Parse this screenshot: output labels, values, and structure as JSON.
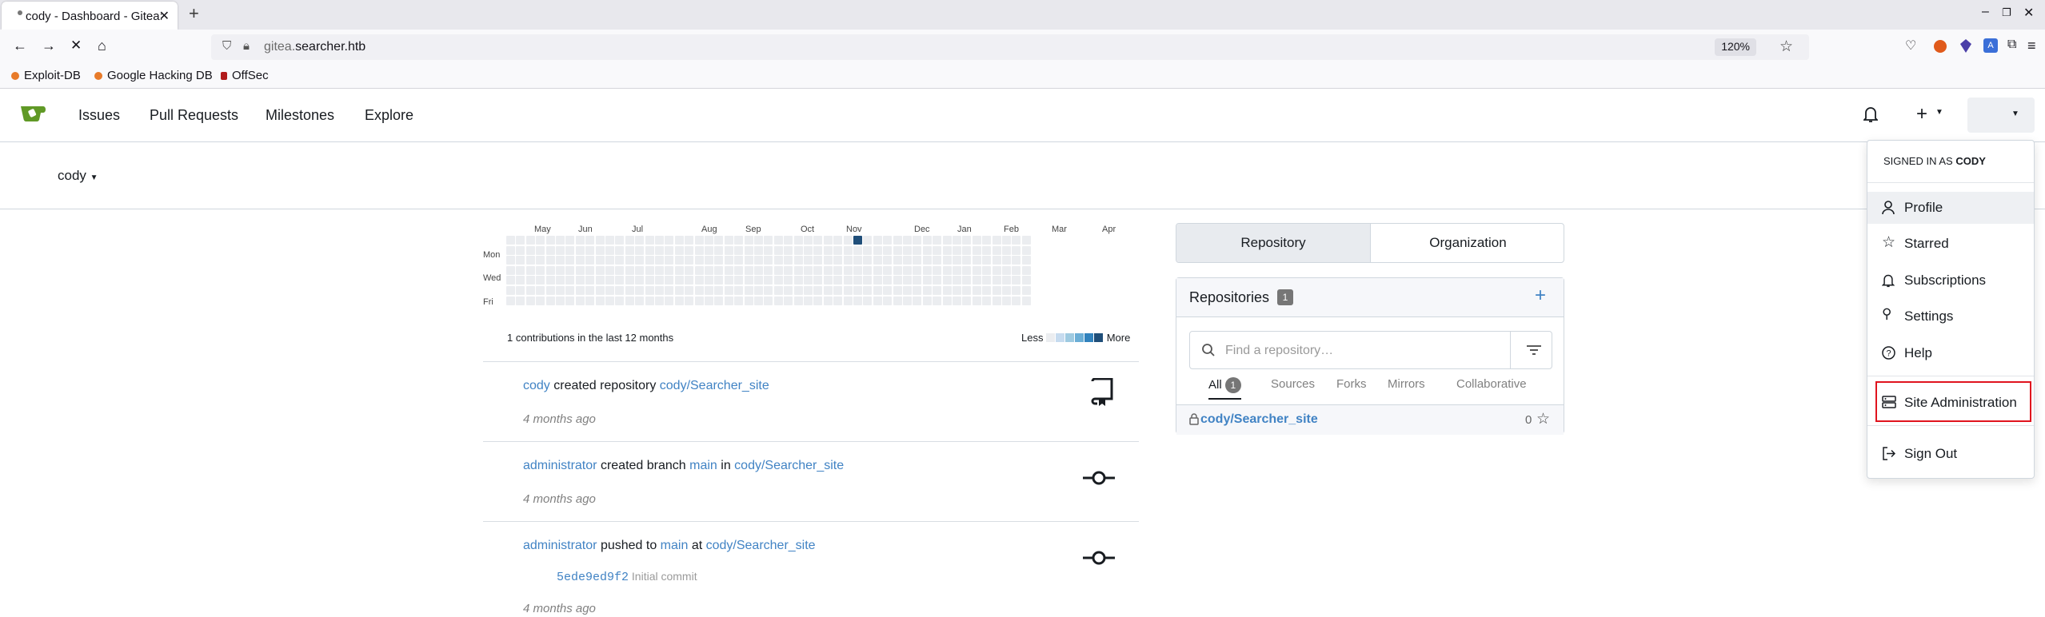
{
  "browser": {
    "tab_title": "cody - Dashboard - Gitea:",
    "url_host_prefix": "gitea.",
    "url_host_main": "searcher.htb",
    "zoom": "120%",
    "bookmarks": [
      "Exploit-DB",
      "Google Hacking DB",
      "OffSec"
    ]
  },
  "nav": {
    "items": [
      "Issues",
      "Pull Requests",
      "Milestones",
      "Explore"
    ]
  },
  "context_user": "cody",
  "heatmap": {
    "months": [
      "May",
      "Jun",
      "Jul",
      "Aug",
      "Sep",
      "Oct",
      "Nov",
      "Dec",
      "Jan",
      "Feb",
      "Mar",
      "Apr"
    ],
    "days": [
      "Mon",
      "Wed",
      "Fri"
    ],
    "summary": "1 contributions in the last 12 months",
    "less": "Less",
    "more": "More",
    "legend_colors": [
      "#ebedf0",
      "#c6dbef",
      "#9ecae1",
      "#6baed6",
      "#3182bd",
      "#1f4e79"
    ],
    "active_cell_color": "#1f4e79"
  },
  "feed": [
    {
      "actor": "cody",
      "verb": "created repository",
      "target": "cody/Searcher_site",
      "time": "4 months ago"
    },
    {
      "actor": "administrator",
      "verb": "created branch",
      "branch": "main",
      "in": "in",
      "target": "cody/Searcher_site",
      "time": "4 months ago"
    },
    {
      "actor": "administrator",
      "verb": "pushed to",
      "branch": "main",
      "at": "at",
      "target": "cody/Searcher_site",
      "sha": "5ede9ed9f2",
      "commit_msg": "Initial commit",
      "time": "4 months ago"
    }
  ],
  "repo_panel": {
    "tabs": [
      "Repository",
      "Organization"
    ],
    "title": "Repositories",
    "count": "1",
    "search_placeholder": "Find a repository…",
    "filters": [
      "All",
      "Sources",
      "Forks",
      "Mirrors",
      "Collaborative"
    ],
    "all_count": "1",
    "repo_name": "cody/Searcher_site",
    "repo_stars": "0"
  },
  "user_menu": {
    "signed_in_prefix": "SIGNED IN AS",
    "signed_in_user": "CODY",
    "items": [
      "Profile",
      "Starred",
      "Subscriptions",
      "Settings",
      "Help",
      "Site Administration",
      "Sign Out"
    ]
  },
  "colors": {
    "link": "#4183c4",
    "gitea_green": "#609926",
    "highlight_box": "#e0141e"
  }
}
